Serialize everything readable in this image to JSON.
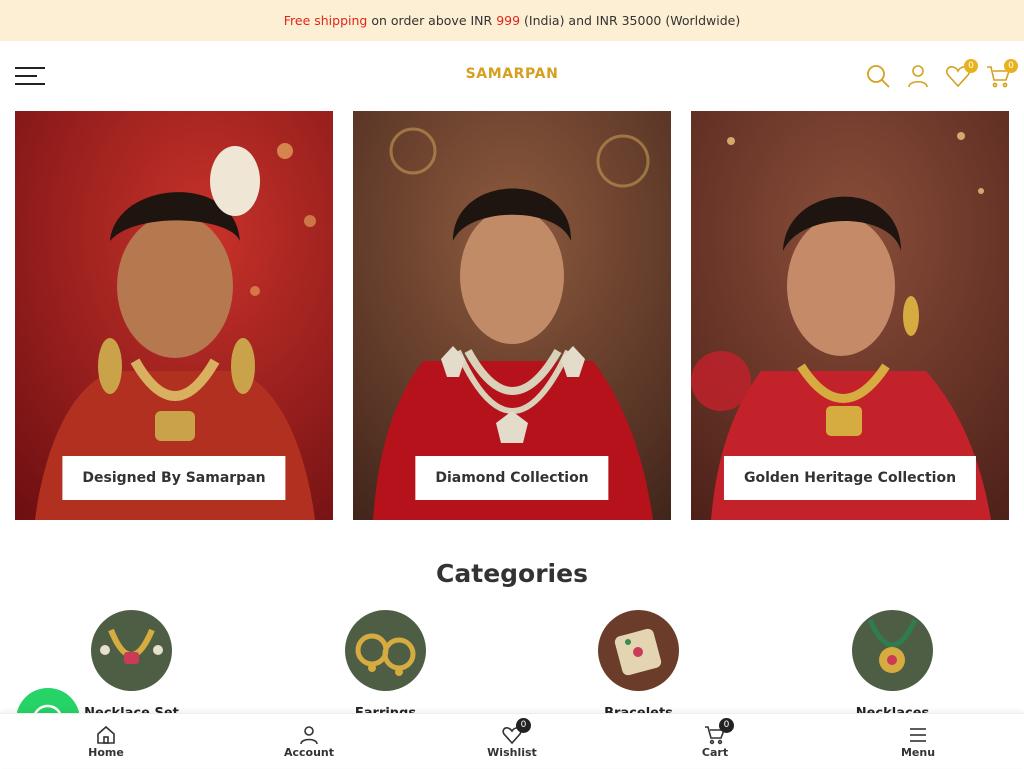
{
  "announcement": {
    "part1": "Free shipping",
    "part2": " on order above INR ",
    "part3": "999",
    "part4": " (India) and INR 35000 (Worldwide)"
  },
  "header": {
    "logo": "SAMARPAN",
    "wishlist_count": "0",
    "cart_count": "0"
  },
  "banners": [
    {
      "label": "Designed By Samarpan"
    },
    {
      "label": "Diamond Collection"
    },
    {
      "label": "Golden Heritage Collection"
    }
  ],
  "categories": {
    "title": "Categories",
    "items": [
      {
        "label": "Necklace Set"
      },
      {
        "label": "Earrings"
      },
      {
        "label": "Bracelets"
      },
      {
        "label": "Necklaces"
      }
    ]
  },
  "bottom_nav": {
    "home": "Home",
    "account": "Account",
    "wishlist": "Wishlist",
    "wishlist_count": "0",
    "cart": "Cart",
    "cart_count": "0",
    "menu": "Menu"
  },
  "colors": {
    "accent": "#e8b21d",
    "logo": "#d5a021",
    "announce_bg": "#fdefd3",
    "highlight": "#e0261b",
    "whatsapp": "#26d366"
  }
}
